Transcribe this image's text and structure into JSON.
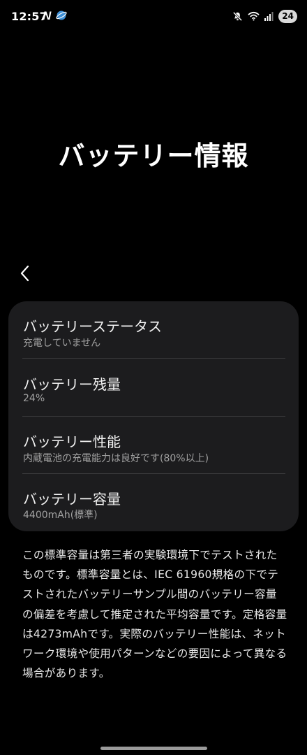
{
  "status_bar": {
    "time": "12:57",
    "app_letter": "N",
    "battery_level": "24",
    "icons": [
      "mute-icon",
      "wifi-icon",
      "signal-icon"
    ]
  },
  "header": {
    "title": "バッテリー情報",
    "back_icon": "chevron-left-icon"
  },
  "items": [
    {
      "title": "バッテリーステータス",
      "subtitle": "充電していません"
    },
    {
      "title": "バッテリー残量",
      "subtitle": "24%"
    },
    {
      "title": "バッテリー性能",
      "subtitle": "内蔵電池の充電能力は良好です(80%以上)"
    },
    {
      "title": "バッテリー容量",
      "subtitle": "4400mAh(標準)"
    }
  ],
  "description": "この標準容量は第三者の実験環境下でテストされたものです。標準容量とは、IEC 61960規格の下でテストされたバッテリーサンプル間のバッテリー容量の偏差を考慮して推定された平均容量です。定格容量は4273mAhです。実際のバッテリー性能は、ネットワーク環境や使用パターンなどの要因によって異なる場合があります。",
  "colors": {
    "background": "#000000",
    "card": "#1c1c1e",
    "subtitle": "#a1a1a1"
  }
}
